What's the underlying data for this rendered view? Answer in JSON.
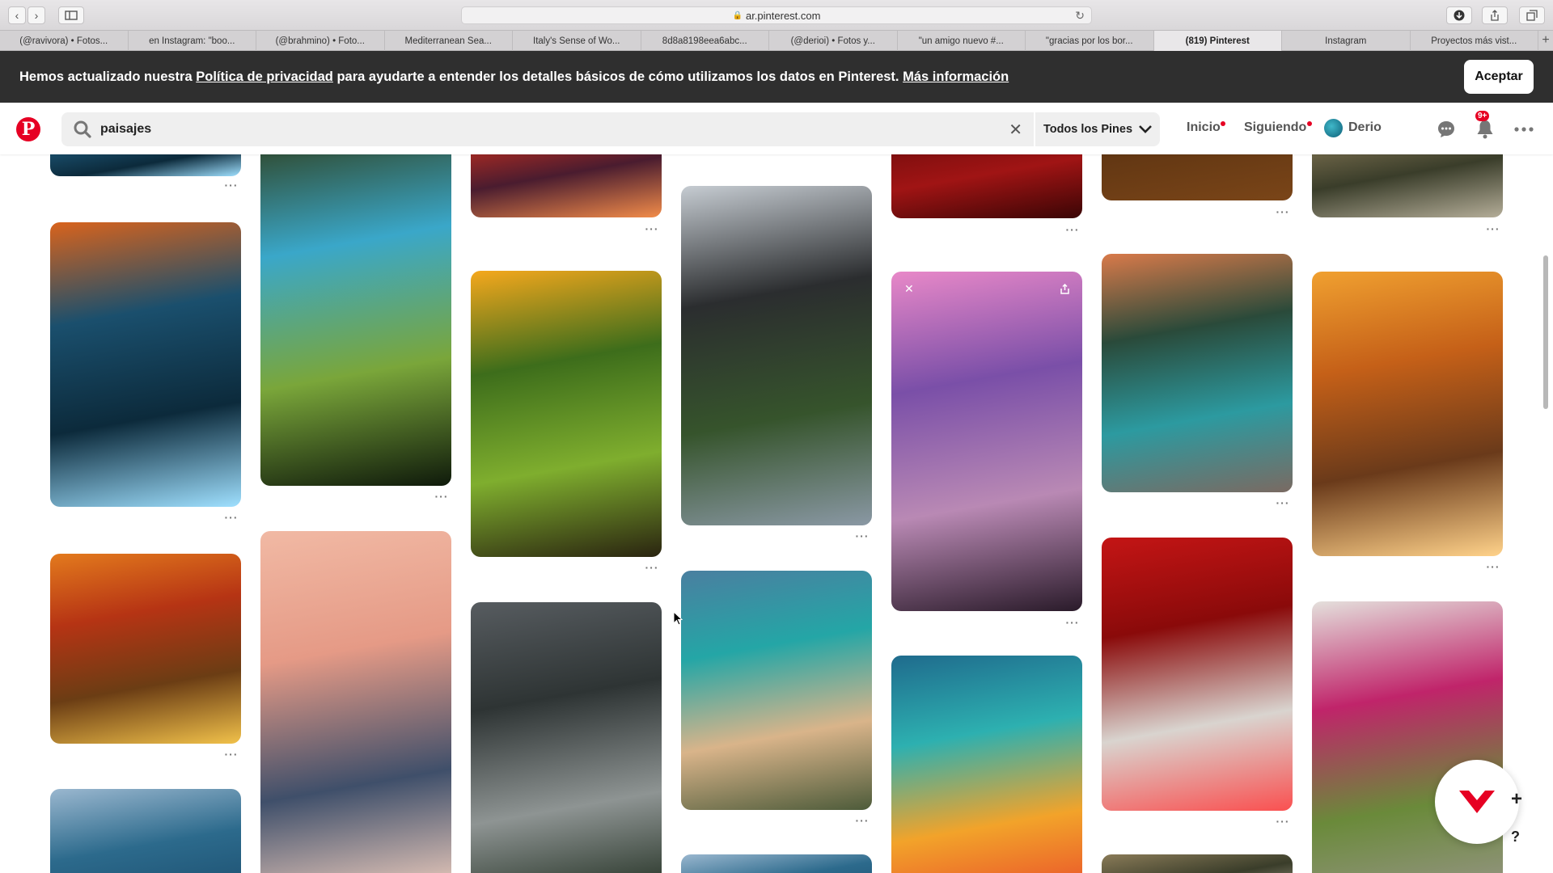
{
  "browser": {
    "url": "ar.pinterest.com",
    "tabs": [
      "(@ravivora) • Fotos...",
      "en Instagram: \"boo...",
      "(@brahmino) • Foto...",
      "Mediterranean Sea...",
      "Italy's Sense of Wo...",
      "8d8a8198eea6abc...",
      "(@derioi) • Fotos y...",
      "\"un amigo nuevo #...",
      "\"gracias por los bor...",
      "(819) Pinterest",
      "Instagram",
      "Proyectos más vist..."
    ],
    "active_tab": 9
  },
  "banner": {
    "text_before": "Hemos actualizado nuestra ",
    "policy_link": "Política de privacidad",
    "text_after": " para ayudarte a entender los detalles básicos de cómo utilizamos los datos en Pinterest. ",
    "more_link": "Más información",
    "accept_label": "Aceptar"
  },
  "header": {
    "logo": "P",
    "search_value": "paisajes",
    "filter_label": "Todos los Pines",
    "nav_home": "Inicio",
    "nav_following": "Siguiendo",
    "user_name": "Derio",
    "notifications_badge": "9+"
  },
  "colors": {
    "brand": "#e60023",
    "banner_bg": "#2f2f2f"
  },
  "pins": [
    {
      "col": 0,
      "subject": "waterfall rocks",
      "palette": [
        "#d9631c",
        "#1a4f6d",
        "#0c2a3b",
        "#9fe0ff"
      ]
    },
    {
      "col": 0,
      "subject": "autumn tree avenue",
      "palette": [
        "#e37a1d",
        "#b63414",
        "#6b3d14",
        "#f1c14a"
      ]
    },
    {
      "col": 0,
      "subject": "sea coastline",
      "palette": [
        "#9ab7cf",
        "#2c6a8c",
        "#1c4e6e"
      ]
    },
    {
      "col": 1,
      "subject": "forest river",
      "palette": [
        "#2e3d1a",
        "#3aa7c9",
        "#7aa63a",
        "#0f1a0b"
      ]
    },
    {
      "col": 1,
      "subject": "palm street sunset",
      "palette": [
        "#f1b9a4",
        "#e59a86",
        "#3f4f6a",
        "#fcd7c4"
      ]
    },
    {
      "col": 2,
      "subject": "lava clouds",
      "palette": [
        "#d3301d",
        "#4a1c2f",
        "#f28c4a"
      ]
    },
    {
      "col": 2,
      "subject": "sunset valley",
      "palette": [
        "#f5a81d",
        "#3d6d1b",
        "#7fae2e",
        "#2a2410"
      ]
    },
    {
      "col": 2,
      "subject": "misty mountains",
      "palette": [
        "#575c60",
        "#2e3434",
        "#8e9493",
        "#1c2a1c"
      ]
    },
    {
      "col": 3,
      "subject": "mountain road",
      "palette": [
        "#c6ccd2",
        "#2b2d2f",
        "#36542c",
        "#8a98a4"
      ]
    },
    {
      "col": 3,
      "subject": "heart beach",
      "palette": [
        "#4a7fa0",
        "#24a6a6",
        "#d9b48a",
        "#4d5b3a"
      ]
    },
    {
      "col": 4,
      "subject": "red tree tops",
      "palette": [
        "#6d0c0c",
        "#a01414",
        "#3a0505"
      ]
    },
    {
      "col": 4,
      "subject": "pink beach",
      "palette": [
        "#e888c8",
        "#7a4fa8",
        "#b989b4",
        "#2a1b2a"
      ]
    },
    {
      "col": 4,
      "subject": "wave sunset",
      "palette": [
        "#1f6b8d",
        "#2db0b0",
        "#f2a32a",
        "#e94a2a"
      ]
    },
    {
      "col": 5,
      "subject": "brown field",
      "palette": [
        "#5a3211",
        "#7a4518"
      ]
    },
    {
      "col": 5,
      "subject": "lake mountains",
      "palette": [
        "#d97a4a",
        "#2a4a3a",
        "#2c9aa0",
        "#7a6a62"
      ]
    },
    {
      "col": 5,
      "subject": "red wetlands",
      "palette": [
        "#c41515",
        "#8a0a0a",
        "#d9d4cf",
        "#fa5050"
      ]
    },
    {
      "col": 6,
      "subject": "hills",
      "palette": [
        "#8a7b58",
        "#3a3d2a",
        "#b4ad98"
      ]
    },
    {
      "col": 6,
      "subject": "pier sunset birds",
      "palette": [
        "#f0a030",
        "#c56018",
        "#6a3a1a",
        "#ffd28a"
      ]
    },
    {
      "col": 6,
      "subject": "flower arch",
      "palette": [
        "#e4e0dc",
        "#c0246a",
        "#6a8a3a",
        "#9a958c"
      ]
    }
  ]
}
